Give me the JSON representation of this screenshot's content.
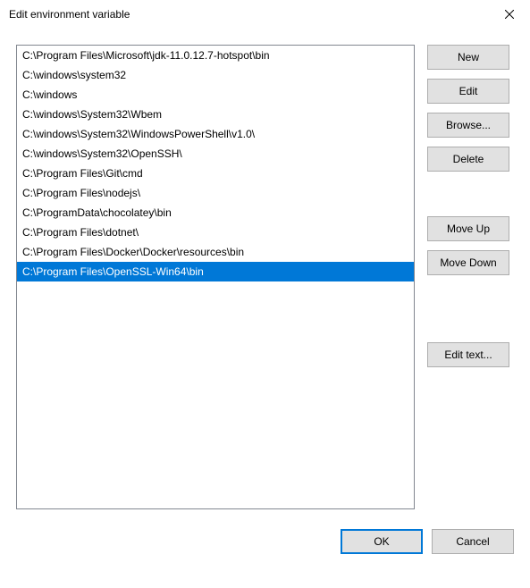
{
  "titlebar": {
    "title": "Edit environment variable"
  },
  "list": {
    "items": [
      "C:\\Program Files\\Microsoft\\jdk-11.0.12.7-hotspot\\bin",
      "C:\\windows\\system32",
      "C:\\windows",
      "C:\\windows\\System32\\Wbem",
      "C:\\windows\\System32\\WindowsPowerShell\\v1.0\\",
      "C:\\windows\\System32\\OpenSSH\\",
      "C:\\Program Files\\Git\\cmd",
      "C:\\Program Files\\nodejs\\",
      "C:\\ProgramData\\chocolatey\\bin",
      "C:\\Program Files\\dotnet\\",
      "C:\\Program Files\\Docker\\Docker\\resources\\bin",
      "C:\\Program Files\\OpenSSL-Win64\\bin"
    ],
    "selected_index": 11
  },
  "buttons": {
    "new": "New",
    "edit": "Edit",
    "browse": "Browse...",
    "delete": "Delete",
    "move_up": "Move Up",
    "move_down": "Move Down",
    "edit_text": "Edit text...",
    "ok": "OK",
    "cancel": "Cancel"
  }
}
